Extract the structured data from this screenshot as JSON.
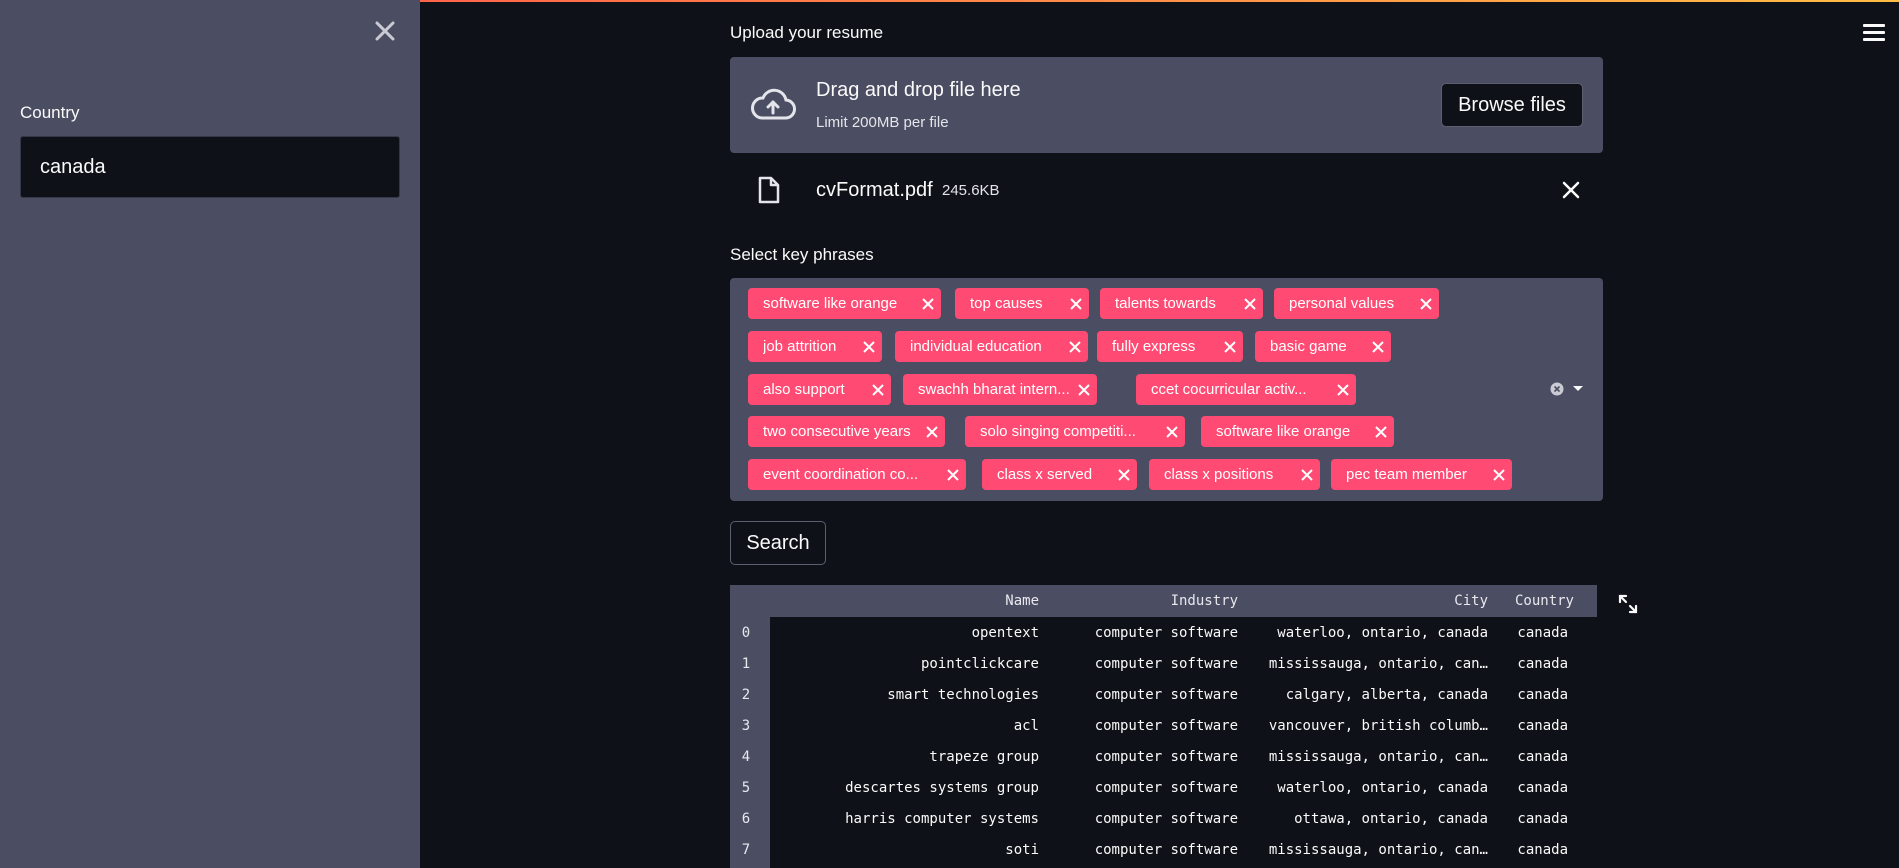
{
  "sidebar": {
    "country_label": "Country",
    "country_value": "canada"
  },
  "upload": {
    "label": "Upload your resume",
    "drag_text": "Drag and drop file here",
    "limit_text": "Limit 200MB per file",
    "browse_label": "Browse files",
    "file_name": "cvFormat.pdf",
    "file_size": "245.6KB"
  },
  "keyphrases": {
    "label": "Select key phrases",
    "tags": [
      "software like orange",
      "top causes",
      "talents towards",
      "personal values",
      "job attrition",
      "individual education",
      "fully express",
      "basic game",
      "also support",
      "swachh bharat intern...",
      "ccet cocurricular activ...",
      "two consecutive years",
      "solo singing competiti...",
      "software like orange",
      "event coordination co...",
      "class x served",
      "class x positions",
      "pec team member"
    ]
  },
  "search_label": "Search",
  "table": {
    "columns": [
      "Name",
      "Industry",
      "City",
      "Country"
    ],
    "rows": [
      {
        "idx": "0",
        "name": "opentext",
        "industry": "computer software",
        "city": "waterloo, ontario, canada",
        "country": "canada"
      },
      {
        "idx": "1",
        "name": "pointclickcare",
        "industry": "computer software",
        "city": "mississauga, ontario, can…",
        "country": "canada"
      },
      {
        "idx": "2",
        "name": "smart technologies",
        "industry": "computer software",
        "city": "calgary, alberta, canada",
        "country": "canada"
      },
      {
        "idx": "3",
        "name": "acl",
        "industry": "computer software",
        "city": "vancouver, british columb…",
        "country": "canada"
      },
      {
        "idx": "4",
        "name": "trapeze group",
        "industry": "computer software",
        "city": "mississauga, ontario, can…",
        "country": "canada"
      },
      {
        "idx": "5",
        "name": "descartes systems group",
        "industry": "computer software",
        "city": "waterloo, ontario, canada",
        "country": "canada"
      },
      {
        "idx": "6",
        "name": "harris computer systems",
        "industry": "computer software",
        "city": "ottawa, ontario, canada",
        "country": "canada"
      },
      {
        "idx": "7",
        "name": "soti",
        "industry": "computer software",
        "city": "mississauga, ontario, can…",
        "country": "canada"
      }
    ]
  },
  "colors": {
    "app_bg": "#0e1117",
    "sidebar_bg": "#4b4e62",
    "tag_bg": "#ff4b73"
  }
}
